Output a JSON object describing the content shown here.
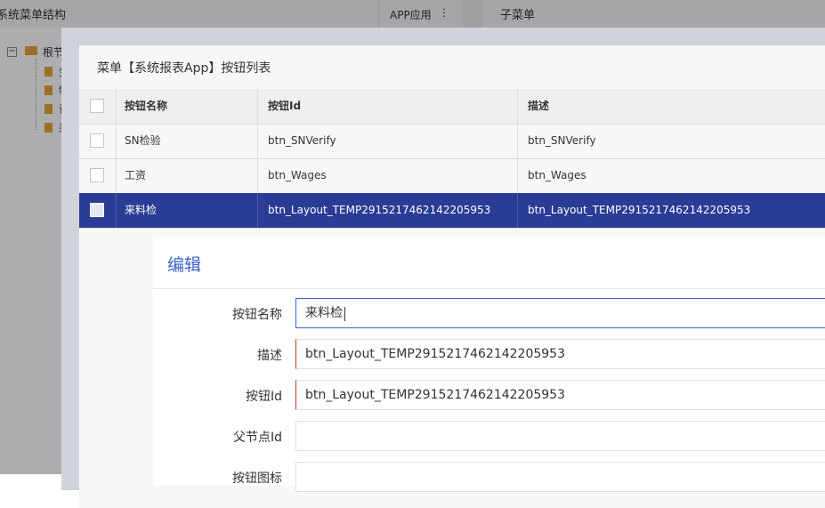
{
  "background": {
    "left_panel_title": "系统菜单结构",
    "app_tab": {
      "label": "APP应用",
      "menu_icon": "kebab-menu-icon"
    },
    "right_panel_title": "子菜单",
    "tree": {
      "root_label": "根节",
      "toggle_symbol": "−",
      "children": [
        "生",
        "物",
        "设",
        "采"
      ]
    }
  },
  "button_list_modal": {
    "title": "菜单【系统报表App】按钮列表",
    "columns": [
      "按钮名称",
      "按钮Id",
      "描述"
    ],
    "rows": [
      {
        "name": "SN检验",
        "id": "btn_SNVerify",
        "desc": "btn_SNVerify",
        "selected": false
      },
      {
        "name": "工资",
        "id": "btn_Wages",
        "desc": "btn_Wages",
        "selected": false
      },
      {
        "name": "来料检",
        "id": "btn_Layout_TEMP2915217462142205953",
        "desc": "btn_Layout_TEMP2915217462142205953",
        "selected": true
      }
    ]
  },
  "edit_dialog": {
    "title": "编辑",
    "fields": [
      {
        "label": "按钮名称",
        "value": "来料检"
      },
      {
        "label": "描述",
        "value": "btn_Layout_TEMP2915217462142205953"
      },
      {
        "label": "按钮Id",
        "value": "btn_Layout_TEMP2915217462142205953"
      },
      {
        "label": "父节点Id",
        "value": ""
      },
      {
        "label": "按钮图标",
        "value": ""
      }
    ]
  },
  "colors": {
    "selected_row": "#2a3c95",
    "dialog_title": "#3a63c8",
    "invalid_border": "#c0392b",
    "folder": "#e8a43a"
  }
}
